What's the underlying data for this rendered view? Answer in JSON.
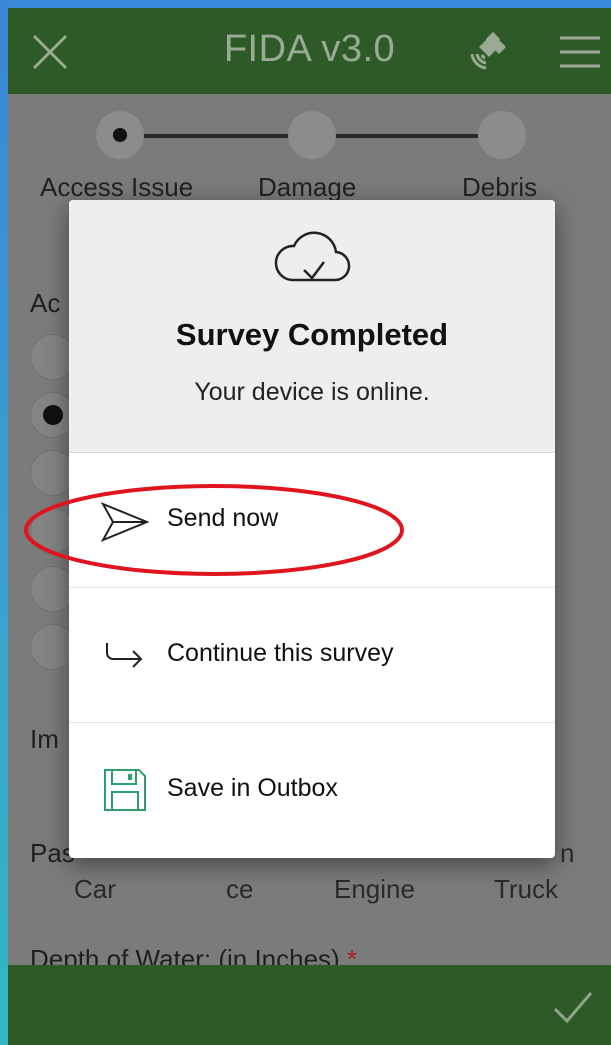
{
  "app": {
    "title": "FIDA v3.0",
    "icons": {
      "close": "close-icon",
      "gps": "satellite-icon",
      "menu": "hamburger-menu-icon",
      "submit": "checkmark-icon"
    },
    "colors": {
      "header": "#2d5a27",
      "highlight": "#e0141e",
      "save_icon": "#2e9e6e"
    }
  },
  "steps": [
    {
      "label": "Access Issue",
      "active": true
    },
    {
      "label": "Damage",
      "active": false
    },
    {
      "label": "Debris",
      "active": false
    }
  ],
  "background_form": {
    "question_1_fragment": "Ac",
    "question_2_fragment": "Im",
    "question_3_fragment": "Pas",
    "options_row": [
      "Car",
      "ce",
      "Engine",
      "Truck"
    ],
    "trailing_fragment": "n",
    "depth_label": "Depth of Water: (in Inches)",
    "required_mark": "*"
  },
  "dialog": {
    "cloud_icon": "cloud-check-icon",
    "title": "Survey Completed",
    "message": "Your device is online.",
    "actions": [
      {
        "label": "Send now",
        "icon": "paper-plane-icon",
        "highlighted": true
      },
      {
        "label": "Continue this survey",
        "icon": "return-arrow-icon",
        "highlighted": false
      },
      {
        "label": "Save in Outbox",
        "icon": "floppy-disk-icon",
        "highlighted": false
      }
    ]
  }
}
